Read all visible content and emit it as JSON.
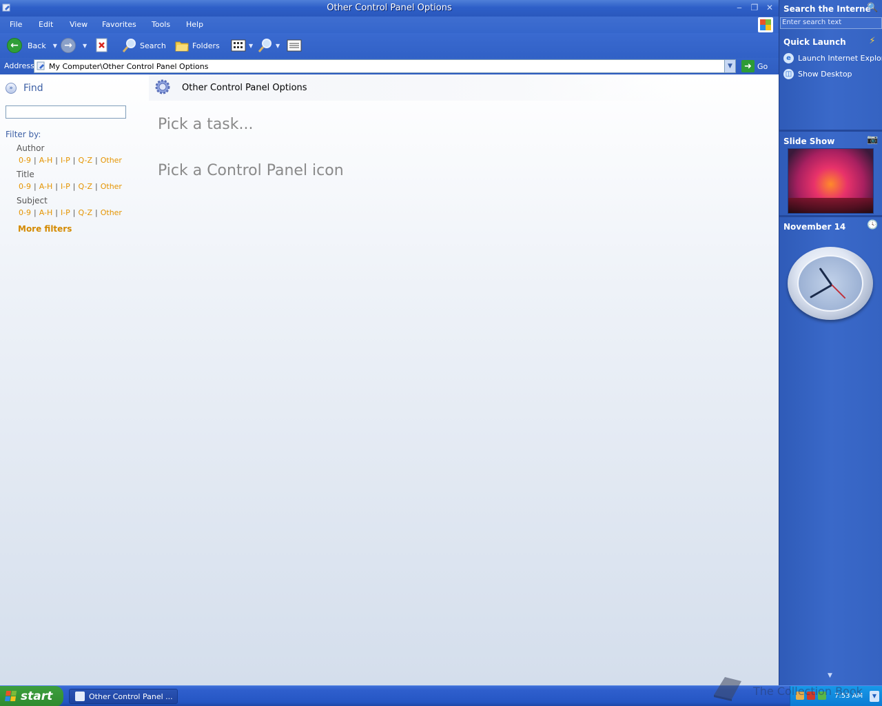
{
  "window": {
    "title": "Other Control Panel Options",
    "controls": {
      "minimize": "‒",
      "restore": "❐",
      "close": "✕"
    }
  },
  "menubar": {
    "items": [
      "File",
      "Edit",
      "View",
      "Favorites",
      "Tools",
      "Help"
    ]
  },
  "toolbar": {
    "back_label": "Back",
    "search_label": "Search",
    "folders_label": "Folders"
  },
  "address": {
    "label": "Address",
    "value": "My Computer\\Other Control Panel Options",
    "go_label": "Go"
  },
  "find_pane": {
    "title": "Find",
    "filter_by": "Filter by:",
    "groups": [
      {
        "label": "Author",
        "links": [
          "0-9",
          "A-H",
          "I-P",
          "Q-Z",
          "Other"
        ]
      },
      {
        "label": "Title",
        "links": [
          "0-9",
          "A-H",
          "I-P",
          "Q-Z",
          "Other"
        ]
      },
      {
        "label": "Subject",
        "links": [
          "0-9",
          "A-H",
          "I-P",
          "Q-Z",
          "Other"
        ]
      }
    ],
    "more_filters": "More filters"
  },
  "main": {
    "header_title": "Other Control Panel Options",
    "task_heading": "Pick a task...",
    "icon_heading": "Pick a Control Panel icon"
  },
  "sidebar": {
    "search_title": "Search the Interne",
    "search_placeholder": "Enter search text",
    "quick_launch_title": "Quick Launch",
    "quick_launch_items": [
      "Launch Internet Explore",
      "Show Desktop"
    ],
    "slideshow_title": "Slide Show",
    "clock_title": "November 14"
  },
  "taskbar": {
    "start_label": "start",
    "task_label": "Other Control Panel ...",
    "watermark": "The Collection Book",
    "time": "7:53 AM"
  },
  "colors": {
    "xp_blue": "#2f5dc0",
    "link_orange": "#e59400",
    "heading_gray": "#8a8a8a",
    "start_green": "#3d9e3d"
  },
  "icons": [
    "app-icon",
    "back-arrow-icon",
    "forward-arrow-icon",
    "stop-icon",
    "search-icon",
    "folders-icon",
    "views-icon",
    "go-icon",
    "gear-icon",
    "find-icon",
    "internet-explorer-icon",
    "show-desktop-icon",
    "camera-icon",
    "clock-icon",
    "windows-logo-icon"
  ]
}
